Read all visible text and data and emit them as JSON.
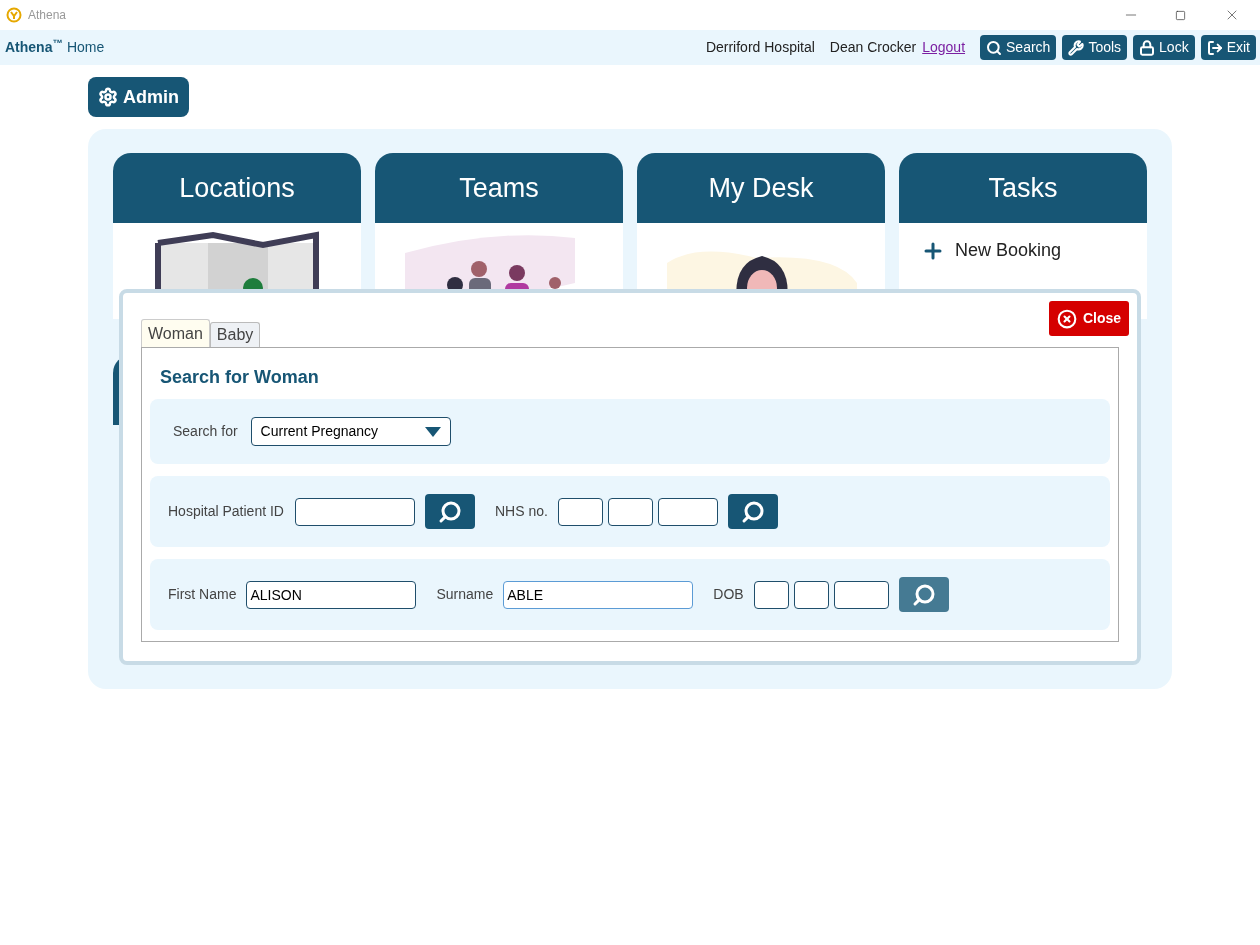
{
  "window": {
    "title": "Athena"
  },
  "topbar": {
    "brand": "Athena$^{™}$",
    "home": "Home",
    "hospital": "Derriford Hospital",
    "user": "Dean Crocker",
    "logout": "Logout",
    "buttons": [
      {
        "kind": "search",
        "label": "Search"
      },
      {
        "kind": "tools",
        "label": "Tools"
      },
      {
        "kind": "lock",
        "label": "Lock"
      },
      {
        "kind": "exit",
        "label": "Exit"
      }
    ]
  },
  "admin_button": "Admin",
  "tiles": [
    {
      "kind": "locations",
      "title": "Locations"
    },
    {
      "kind": "teams",
      "title": "Teams"
    },
    {
      "kind": "desk",
      "title": "My Desk"
    },
    {
      "kind": "tasks",
      "title": "Tasks",
      "items": [
        "New Booking"
      ]
    }
  ],
  "dialog": {
    "close": "Close",
    "tabs": [
      {
        "label": "Woman",
        "selected": true
      },
      {
        "label": "Baby",
        "selected": false
      }
    ],
    "heading": "Search for Woman",
    "search_for": {
      "label": "Search for",
      "value": "Current Pregnancy"
    },
    "id_row": {
      "hospital_id_label": "Hospital Patient ID",
      "hospital_search_focused": false,
      "nhs_label": "NHS no.",
      "nhs_search_focused": false
    },
    "name_row": {
      "first_name_label": "First Name",
      "first_name": "ALISON",
      "first_name_focused": false,
      "surname_label": "Surname",
      "surname": "ABLE",
      "surname_focused": true,
      "dob_label": "DOB",
      "dob_search_focused": true
    }
  }
}
